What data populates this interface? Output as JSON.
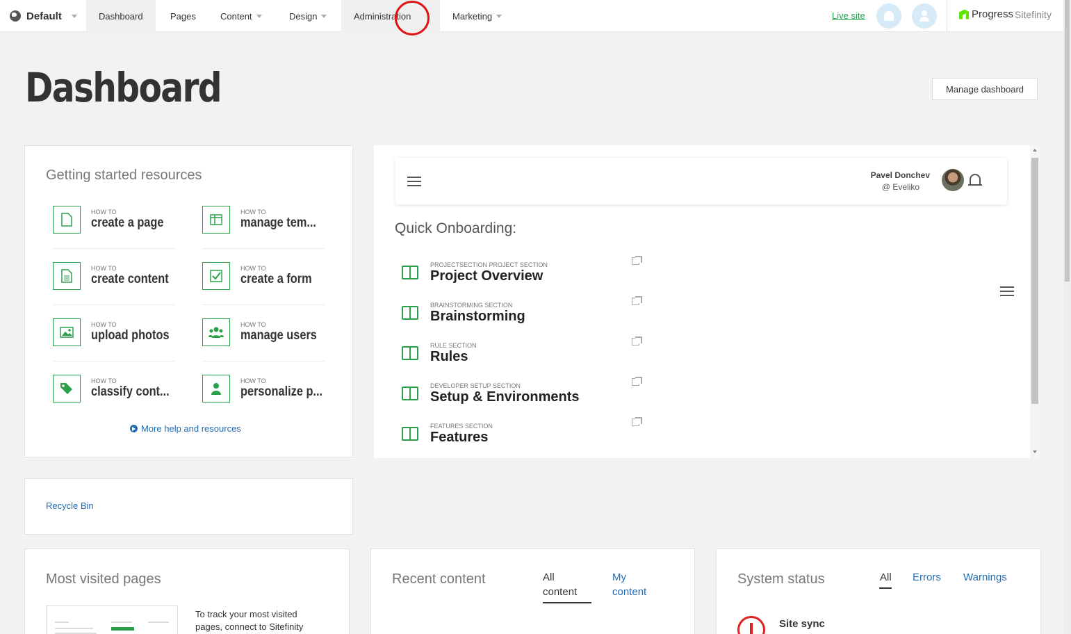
{
  "topnav": {
    "site": "Default",
    "items": [
      "Dashboard",
      "Pages",
      "Content",
      "Design",
      "Administration",
      "Marketing"
    ],
    "live_site": "Live site",
    "logo_main": "Progress",
    "logo_sub": "Sitefinity"
  },
  "page": {
    "title": "Dashboard",
    "manage_button": "Manage dashboard"
  },
  "getting_started": {
    "title": "Getting started resources",
    "howto_label": "HOW TO",
    "items": [
      {
        "label": "create a page",
        "icon": "page-icon"
      },
      {
        "label": "manage tem...",
        "icon": "template-icon"
      },
      {
        "label": "create content",
        "icon": "document-icon"
      },
      {
        "label": "create a form",
        "icon": "checkbox-icon"
      },
      {
        "label": "upload photos",
        "icon": "image-icon"
      },
      {
        "label": "manage users",
        "icon": "users-icon"
      },
      {
        "label": "classify cont...",
        "icon": "tags-icon"
      },
      {
        "label": "personalize p...",
        "icon": "person-icon"
      }
    ],
    "more_link": "More help and resources"
  },
  "onboarding": {
    "user_name": "Pavel Donchev",
    "user_handle": "@ Eveliko",
    "title": "Quick Onboarding:",
    "items": [
      {
        "section": "PROJECTSECTION PROJECT SECTION",
        "label": "Project Overview"
      },
      {
        "section": "BRAINSTORMING SECTION",
        "label": "Brainstorming"
      },
      {
        "section": "RULE SECTION",
        "label": "Rules"
      },
      {
        "section": "DEVELOPER SETUP SECTION",
        "label": "Setup & Environments"
      },
      {
        "section": "FEATURES SECTION",
        "label": "Features"
      }
    ]
  },
  "recycle_bin": "Recycle Bin",
  "most_visited": {
    "title": "Most visited pages",
    "text": "To track your most visited pages, connect to Sitefinity"
  },
  "recent_content": {
    "title": "Recent content",
    "tab_all": "All content",
    "tab_mine": "My content"
  },
  "system_status": {
    "title": "System status",
    "tabs": [
      "All",
      "Errors",
      "Warnings"
    ],
    "item": "Site sync"
  },
  "colors": {
    "accent_green": "#2aa04a",
    "link_blue": "#1f6db4",
    "error_red": "#d22222"
  }
}
